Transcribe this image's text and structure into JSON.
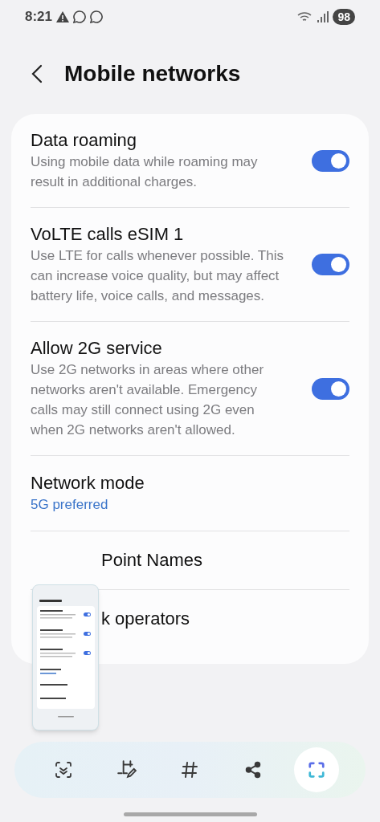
{
  "status_bar": {
    "time": "8:21",
    "battery": "98"
  },
  "header": {
    "title": "Mobile networks"
  },
  "settings": [
    {
      "kind": "toggle",
      "title": "Data roaming",
      "description": "Using mobile data while roaming may result in additional charges.",
      "on": true
    },
    {
      "kind": "toggle",
      "title": "VoLTE calls eSIM 1",
      "description": "Use LTE for calls whenever possible. This can increase voice quality, but may affect battery life, voice calls, and messages.",
      "on": true
    },
    {
      "kind": "toggle",
      "title": "Allow 2G service",
      "description": "Use 2G networks in areas where other networks aren't available. Emergency calls may still connect using 2G even when 2G networks aren't allowed.",
      "on": true
    },
    {
      "kind": "value",
      "title": "Network mode",
      "value": "5G preferred"
    },
    {
      "kind": "partial",
      "title": "Point Names"
    },
    {
      "kind": "partial",
      "title": "k operators"
    }
  ],
  "toolbar": [
    {
      "kind": "scroll"
    },
    {
      "kind": "edit"
    },
    {
      "kind": "tag"
    },
    {
      "kind": "share"
    },
    {
      "kind": "capture"
    }
  ]
}
